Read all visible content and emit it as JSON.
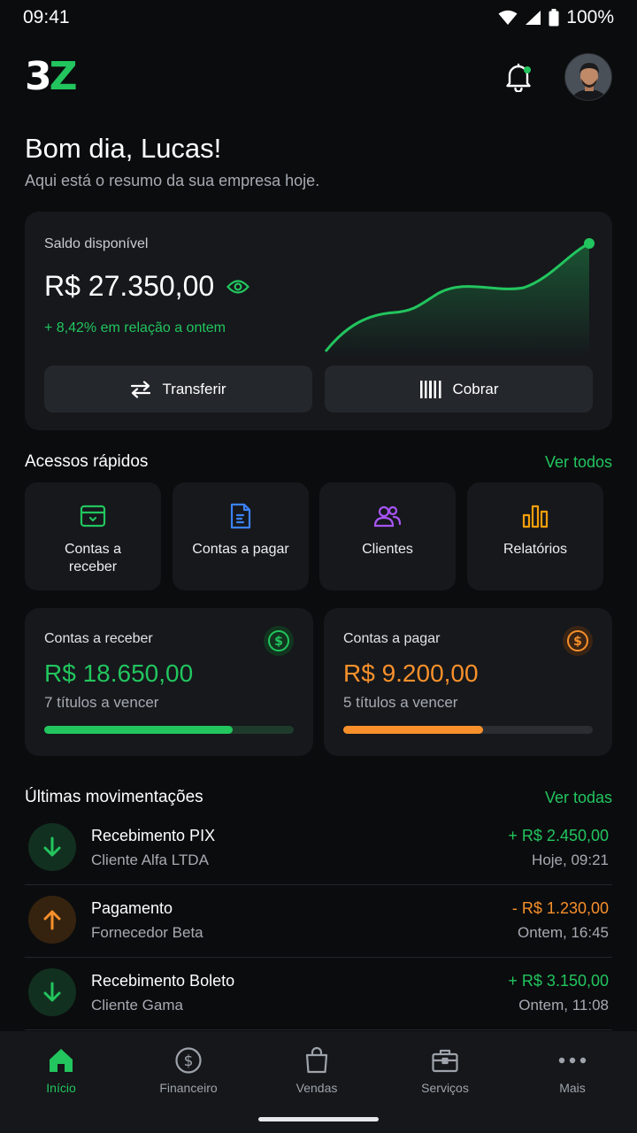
{
  "status_bar": {
    "time": "09:41",
    "battery": "100%"
  },
  "header": {
    "logo_part1": "3",
    "logo_part2": "Z",
    "has_notification": true
  },
  "greeting": {
    "title": "Bom dia, Lucas!",
    "subtitle": "Aqui está o resumo da sua empresa hoje."
  },
  "balance": {
    "label": "Saldo disponível",
    "value": "R$ 27.350,00",
    "change": "+ 8,42% em relação a ontem",
    "transfer_label": "Transferir",
    "charge_label": "Cobrar"
  },
  "quick_access": {
    "title": "Acessos rápidos",
    "link": "Ver todos",
    "items": [
      {
        "label": "Contas a receber",
        "icon": "wallet-icon",
        "color": "#22c55e"
      },
      {
        "label": "Contas a pagar",
        "icon": "document-icon",
        "color": "#3b82f6"
      },
      {
        "label": "Clientes",
        "icon": "users-icon",
        "color": "#a855f7"
      },
      {
        "label": "Relatórios",
        "icon": "bar-chart-icon",
        "color": "#f59e0b"
      }
    ]
  },
  "summary": {
    "receivable": {
      "label": "Contas a receber",
      "value": "R$ 18.650,00",
      "sub": "7 títulos a vencer",
      "progress": 0.755,
      "color": "#22c55e"
    },
    "payable": {
      "label": "Contas a pagar",
      "value": "R$ 9.200,00",
      "sub": "5 títulos a vencer",
      "progress": 0.56,
      "color": "#f7902b"
    }
  },
  "transactions": {
    "title": "Últimas movimentações",
    "link": "Ver todas",
    "items": [
      {
        "title": "Recebimento PIX",
        "sub": "Cliente Alfa LTDA",
        "amount": "+ R$ 2.450,00",
        "time": "Hoje, 09:21",
        "type": "in"
      },
      {
        "title": "Pagamento",
        "sub": "Fornecedor Beta",
        "amount": "- R$ 1.230,00",
        "time": "Ontem, 16:45",
        "type": "out"
      },
      {
        "title": "Recebimento Boleto",
        "sub": "Cliente Gama",
        "amount": "+ R$ 3.150,00",
        "time": "Ontem, 11:08",
        "type": "in"
      }
    ]
  },
  "nav": {
    "items": [
      {
        "label": "Início",
        "icon": "home-icon",
        "active": true
      },
      {
        "label": "Financeiro",
        "icon": "dollar-circle-icon",
        "active": false
      },
      {
        "label": "Vendas",
        "icon": "shopping-bag-icon",
        "active": false
      },
      {
        "label": "Serviços",
        "icon": "briefcase-icon",
        "active": false
      },
      {
        "label": "Mais",
        "icon": "more-icon",
        "active": false
      }
    ]
  },
  "colors": {
    "accent": "#22c55e",
    "warning": "#f7902b",
    "background": "#0b0c0e",
    "card": "#16181c"
  }
}
